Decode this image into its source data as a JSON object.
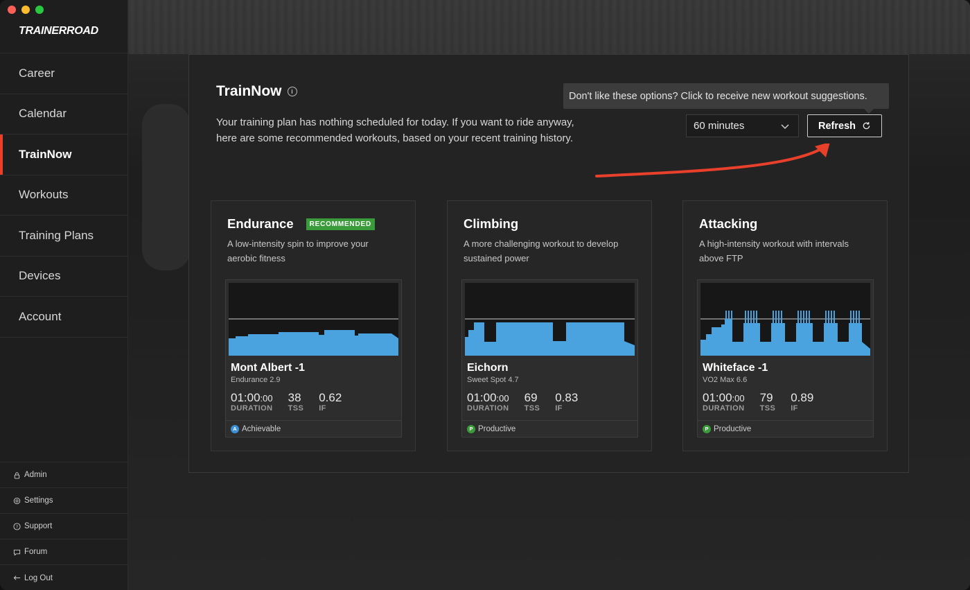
{
  "app": {
    "logo": "TRAINERROAD"
  },
  "sidebar": {
    "items": [
      {
        "label": "Career",
        "active": false
      },
      {
        "label": "Calendar",
        "active": false
      },
      {
        "label": "TrainNow",
        "active": true
      },
      {
        "label": "Workouts",
        "active": false
      },
      {
        "label": "Training Plans",
        "active": false
      },
      {
        "label": "Devices",
        "active": false
      },
      {
        "label": "Account",
        "active": false
      }
    ],
    "bottom": [
      {
        "label": "Admin",
        "icon": "lock-icon"
      },
      {
        "label": "Settings",
        "icon": "gear-icon"
      },
      {
        "label": "Support",
        "icon": "question-icon"
      },
      {
        "label": "Forum",
        "icon": "chat-icon"
      },
      {
        "label": "Log Out",
        "icon": "arrow-left-icon"
      }
    ]
  },
  "main": {
    "title": "TrainNow",
    "description": "Your training plan has nothing scheduled for today. If you want to ride anyway, here are some recommended workouts, based on your recent training history.",
    "tooltip": "Don't like these options? Click to receive new workout suggestions.",
    "duration_select": {
      "value": "60 minutes"
    },
    "refresh_label": "Refresh",
    "annotation_color": "#e8402a"
  },
  "cards": [
    {
      "category": "Endurance",
      "badge": "RECOMMENDED",
      "description": "A low-intensity spin to improve your aerobic fitness",
      "workout": {
        "name": "Mont Albert -1",
        "subtitle": "Endurance 2.9",
        "duration_main": "01:00",
        "duration_sec": ":00",
        "duration_label": "DURATION",
        "tss": "38",
        "tss_label": "TSS",
        "if": "0.62",
        "if_label": "IF",
        "level_letter": "A",
        "level_label": "Achievable",
        "level_color": "#3b8fd9"
      }
    },
    {
      "category": "Climbing",
      "badge": "",
      "description": "A more challenging workout to develop sustained power",
      "workout": {
        "name": "Eichorn",
        "subtitle": "Sweet Spot 4.7",
        "duration_main": "01:00",
        "duration_sec": ":00",
        "duration_label": "DURATION",
        "tss": "69",
        "tss_label": "TSS",
        "if": "0.83",
        "if_label": "IF",
        "level_letter": "P",
        "level_label": "Productive",
        "level_color": "#3a9b3a"
      }
    },
    {
      "category": "Attacking",
      "badge": "",
      "description": "A high-intensity workout with intervals above FTP",
      "workout": {
        "name": "Whiteface -1",
        "subtitle": "VO2 Max 6.6",
        "duration_main": "01:00",
        "duration_sec": ":00",
        "duration_label": "DURATION",
        "tss": "79",
        "tss_label": "TSS",
        "if": "0.89",
        "if_label": "IF",
        "level_letter": "P",
        "level_label": "Productive",
        "level_color": "#3a9b3a"
      }
    }
  ],
  "colors": {
    "profile_fill": "#4aa3df",
    "ftp_line": "#cfcfcf"
  }
}
